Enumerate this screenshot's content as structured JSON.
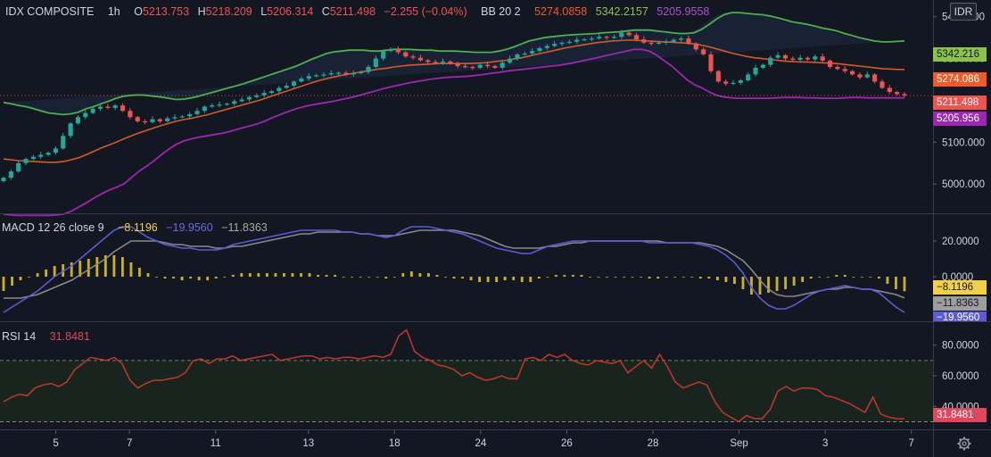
{
  "header": {
    "symbol": "IDX COMPOSITE",
    "interval": "1h",
    "o_label": "O",
    "o_value": "5213.753",
    "h_label": "H",
    "h_value": "5218.209",
    "l_label": "L",
    "l_value": "5206.314",
    "c_label": "C",
    "c_value": "5211.498",
    "change": "−2.255 (−0.04%)",
    "bb_label": "BB 20 2",
    "bb_basis": "5274.0858",
    "bb_upper": "5342.2157",
    "bb_lower": "5205.9558",
    "currency_button": "IDR"
  },
  "macd_header": {
    "label": "MACD 12 26 close 9",
    "hist": "−8.1196",
    "macd": "−19.9560",
    "signal": "−11.8363"
  },
  "rsi_header": {
    "label": "RSI 14",
    "value": "31.8481"
  },
  "price_axis": {
    "ticks": [
      "5400.000",
      "5300.000",
      "5200.000",
      "5100.000",
      "5000.000"
    ],
    "labels": {
      "upper": "5342.216",
      "basis": "5274.086",
      "close": "5211.498",
      "lower": "5205.956"
    }
  },
  "macd_axis": {
    "ticks": [
      "20.0000",
      "0.0000"
    ],
    "labels": {
      "hist": "−8.1196",
      "signal": "−11.8363",
      "macd": "−19.9560"
    }
  },
  "rsi_axis": {
    "ticks": [
      "80.0000",
      "60.0000",
      "40.0000"
    ],
    "label": "31.8481"
  },
  "time_axis": [
    "5",
    "7",
    "11",
    "13",
    "18",
    "24",
    "26",
    "28",
    "Sep",
    "3",
    "7"
  ],
  "colors": {
    "background": "#131722",
    "up": "#26a69a",
    "up_bright": "#4caf50",
    "down": "#ef5350",
    "bb_upper": "#4caf50",
    "bb_basis": "#d35b2a",
    "bb_lower": "#9c27b0",
    "macd_line": "#5b5bd6",
    "signal_line": "#8a8a8a",
    "histogram": "#c9b026",
    "rsi_line": "#c0392b",
    "rsi_band": "#1e2b1e",
    "close_label": "#ef5350",
    "basis_label": "#f05a28",
    "upper_label": "#8bc34a",
    "lower_label": "#9c27b0"
  },
  "chart_data": [
    {
      "type": "candlestick",
      "title": "IDX COMPOSITE",
      "ylim": [
        4930,
        5440
      ],
      "legend": "top-left",
      "grid": false,
      "x_ticks": [
        "5",
        "7",
        "11",
        "13",
        "18",
        "24",
        "26",
        "28",
        "Sep",
        "3",
        "7"
      ],
      "price": [
        5015,
        5030,
        5050,
        5060,
        5065,
        5070,
        5075,
        5085,
        5115,
        5145,
        5160,
        5170,
        5180,
        5185,
        5182,
        5188,
        5175,
        5160,
        5150,
        5148,
        5155,
        5150,
        5157,
        5160,
        5162,
        5167,
        5175,
        5185,
        5188,
        5190,
        5192,
        5198,
        5202,
        5208,
        5212,
        5218,
        5222,
        5230,
        5235,
        5245,
        5252,
        5258,
        5260,
        5262,
        5265,
        5266,
        5262,
        5265,
        5268,
        5280,
        5300,
        5318,
        5322,
        5315,
        5305,
        5302,
        5296,
        5292,
        5290,
        5293,
        5288,
        5282,
        5280,
        5278,
        5285,
        5282,
        5278,
        5290,
        5300,
        5310,
        5312,
        5318,
        5325,
        5330,
        5335,
        5338,
        5340,
        5345,
        5346,
        5348,
        5352,
        5350,
        5352,
        5362,
        5356,
        5346,
        5338,
        5336,
        5338,
        5340,
        5345,
        5348,
        5336,
        5322,
        5310,
        5270,
        5245,
        5240,
        5242,
        5248,
        5262,
        5278,
        5285,
        5302,
        5308,
        5300,
        5297,
        5302,
        5298,
        5305,
        5295,
        5280,
        5275,
        5270,
        5262,
        5255,
        5262,
        5245,
        5230,
        5220,
        5215,
        5212
      ],
      "bb_upper": [
        5195,
        5192,
        5188,
        5185,
        5180,
        5175,
        5170,
        5168,
        5166,
        5168,
        5172,
        5180,
        5185,
        5192,
        5198,
        5205,
        5210,
        5212,
        5213,
        5212,
        5210,
        5208,
        5205,
        5202,
        5203,
        5206,
        5210,
        5215,
        5220,
        5225,
        5230,
        5235,
        5240,
        5246,
        5252,
        5258,
        5264,
        5270,
        5276,
        5282,
        5290,
        5298,
        5305,
        5312,
        5316,
        5318,
        5320,
        5320,
        5320,
        5318,
        5318,
        5320,
        5322,
        5322,
        5322,
        5321,
        5320,
        5320,
        5318,
        5318,
        5318,
        5317,
        5316,
        5315,
        5315,
        5315,
        5318,
        5322,
        5328,
        5335,
        5342,
        5346,
        5350,
        5352,
        5354,
        5356,
        5357,
        5358,
        5359,
        5360,
        5362,
        5363,
        5364,
        5366,
        5368,
        5368,
        5368,
        5366,
        5364,
        5362,
        5360,
        5360,
        5362,
        5370,
        5382,
        5395,
        5405,
        5410,
        5410,
        5408,
        5406,
        5405,
        5402,
        5398,
        5393,
        5388,
        5385,
        5382,
        5378,
        5373,
        5370,
        5366,
        5360,
        5355,
        5350,
        5346,
        5342,
        5340,
        5340,
        5341,
        5342
      ],
      "bb_basis": [
        5060,
        5058,
        5056,
        5055,
        5054,
        5053,
        5052,
        5052,
        5054,
        5058,
        5063,
        5070,
        5078,
        5086,
        5093,
        5100,
        5108,
        5115,
        5122,
        5128,
        5134,
        5140,
        5145,
        5150,
        5154,
        5157,
        5161,
        5165,
        5170,
        5175,
        5180,
        5185,
        5190,
        5195,
        5200,
        5206,
        5212,
        5218,
        5224,
        5230,
        5236,
        5242,
        5247,
        5252,
        5256,
        5260,
        5263,
        5266,
        5269,
        5272,
        5275,
        5277,
        5280,
        5282,
        5284,
        5285,
        5286,
        5287,
        5288,
        5288,
        5288,
        5288,
        5288,
        5289,
        5290,
        5292,
        5294,
        5296,
        5299,
        5302,
        5306,
        5310,
        5314,
        5318,
        5322,
        5326,
        5329,
        5332,
        5335,
        5338,
        5340,
        5342,
        5343,
        5344,
        5344,
        5343,
        5342,
        5341,
        5340,
        5339,
        5338,
        5337,
        5335,
        5332,
        5328,
        5323,
        5318,
        5313,
        5309,
        5305,
        5302,
        5300,
        5298,
        5296,
        5294,
        5293,
        5292,
        5292,
        5291,
        5290,
        5289,
        5288,
        5286,
        5284,
        5282,
        5280,
        5278,
        5276,
        5275,
        5274,
        5274
      ],
      "bb_lower": [
        4928,
        4926,
        4925,
        4925,
        4925,
        4925,
        4925,
        4926,
        4928,
        4935,
        4945,
        4955,
        4966,
        4976,
        4985,
        4992,
        5000,
        5015,
        5030,
        5042,
        5055,
        5070,
        5083,
        5095,
        5103,
        5108,
        5112,
        5115,
        5118,
        5121,
        5125,
        5130,
        5135,
        5140,
        5145,
        5152,
        5160,
        5167,
        5174,
        5180,
        5185,
        5189,
        5192,
        5195,
        5198,
        5202,
        5206,
        5210,
        5215,
        5220,
        5225,
        5230,
        5234,
        5238,
        5242,
        5245,
        5248,
        5251,
        5253,
        5255,
        5256,
        5257,
        5258,
        5260,
        5262,
        5265,
        5267,
        5270,
        5272,
        5274,
        5276,
        5278,
        5280,
        5282,
        5284,
        5287,
        5290,
        5294,
        5298,
        5302,
        5306,
        5310,
        5314,
        5318,
        5322,
        5322,
        5318,
        5308,
        5295,
        5282,
        5266,
        5250,
        5238,
        5230,
        5220,
        5212,
        5208,
        5206,
        5205,
        5205,
        5205,
        5205,
        5205,
        5206,
        5207,
        5207,
        5207,
        5206,
        5206,
        5205,
        5205,
        5205,
        5206,
        5207,
        5207,
        5206,
        5206,
        5206,
        5206,
        5206,
        5206
      ],
      "current_close": 5211.498
    },
    {
      "type": "line",
      "title": "MACD 12 26 close 9",
      "ylim": [
        -25,
        35
      ],
      "grid": false,
      "series": [
        {
          "name": "MACD",
          "values": [
            -20,
            -17,
            -14,
            -11,
            -8,
            -4,
            0,
            3,
            6,
            10,
            14,
            18,
            22,
            26,
            28,
            28,
            25,
            22,
            20,
            18,
            17,
            16,
            16,
            15,
            15,
            15,
            16,
            18,
            19,
            20,
            21,
            22,
            23,
            24,
            25,
            26,
            26,
            26,
            26,
            26,
            25,
            25,
            24,
            24,
            23,
            22,
            23,
            26,
            28,
            28,
            28,
            27,
            26,
            25,
            24,
            22,
            20,
            18,
            16,
            15,
            14,
            13,
            13,
            15,
            17,
            18,
            19,
            20,
            20,
            20,
            20,
            20,
            20,
            20,
            20,
            20,
            19,
            19,
            19,
            19,
            19,
            19,
            18,
            17,
            15,
            12,
            8,
            2,
            -6,
            -12,
            -16,
            -18,
            -18,
            -16,
            -13,
            -10,
            -8,
            -7,
            -6,
            -5,
            -6,
            -7,
            -7,
            -9,
            -13,
            -17,
            -20
          ]
        },
        {
          "name": "Signal",
          "values": [
            -12,
            -12,
            -12,
            -11,
            -10,
            -8,
            -6,
            -4,
            -2,
            1,
            4,
            7,
            10,
            14,
            17,
            20,
            20,
            20,
            20,
            19,
            18,
            18,
            17,
            17,
            17,
            16,
            16,
            17,
            17,
            18,
            19,
            20,
            21,
            22,
            23,
            24,
            24,
            25,
            25,
            25,
            25,
            25,
            24,
            24,
            23,
            23,
            23,
            24,
            25,
            26,
            26,
            26,
            26,
            26,
            25,
            24,
            23,
            21,
            19,
            17,
            16,
            16,
            16,
            16,
            17,
            17,
            18,
            19,
            19,
            20,
            20,
            20,
            20,
            20,
            20,
            20,
            20,
            20,
            19,
            19,
            19,
            19,
            19,
            18,
            17,
            15,
            12,
            9,
            4,
            -2,
            -7,
            -10,
            -11,
            -11,
            -10,
            -9,
            -8,
            -7,
            -7,
            -6,
            -6,
            -7,
            -7,
            -8,
            -9,
            -10,
            -11.84
          ]
        },
        {
          "name": "Histogram",
          "values": [
            -8,
            -5,
            -2,
            0,
            2,
            4,
            6,
            7,
            8,
            9,
            10,
            11,
            12,
            12,
            11,
            8,
            5,
            2,
            0,
            -1,
            -1,
            -2,
            -1,
            -2,
            -2,
            -1,
            0,
            1,
            2,
            2,
            2,
            2,
            2,
            2,
            2,
            2,
            2,
            1,
            1,
            1,
            0,
            0,
            0,
            0,
            0,
            -1,
            0,
            2,
            3,
            2,
            2,
            1,
            0,
            -1,
            -1,
            -2,
            -3,
            -3,
            -3,
            -2,
            -2,
            -3,
            -3,
            -1,
            0,
            1,
            1,
            1,
            1,
            0,
            0,
            0,
            0,
            0,
            0,
            0,
            -1,
            -1,
            0,
            0,
            0,
            0,
            -1,
            -1,
            -2,
            -3,
            -4,
            -7,
            -10,
            -10,
            -9,
            -8,
            -7,
            -5,
            -3,
            -1,
            0,
            0,
            1,
            1,
            0,
            0,
            0,
            -1,
            -4,
            -7,
            -8.12
          ]
        }
      ]
    },
    {
      "type": "line",
      "title": "RSI 14",
      "ylim": [
        25,
        95
      ],
      "grid": false,
      "bands": [
        30,
        70
      ],
      "series": [
        {
          "name": "RSI",
          "values": [
            43,
            46,
            48,
            47,
            52,
            54,
            55,
            53,
            56,
            64,
            68,
            72,
            71,
            70,
            72,
            68,
            57,
            52,
            55,
            57,
            57,
            58,
            59,
            62,
            70,
            71,
            68,
            71,
            71,
            73,
            70,
            71,
            72,
            73,
            74,
            70,
            71,
            72,
            73,
            73,
            71,
            72,
            71,
            72,
            72,
            71,
            72,
            73,
            72,
            74,
            86,
            90,
            76,
            72,
            70,
            67,
            66,
            64,
            60,
            62,
            59,
            57,
            58,
            60,
            58,
            58,
            71,
            72,
            70,
            74,
            72,
            74,
            70,
            68,
            67,
            70,
            69,
            68,
            70,
            62,
            66,
            70,
            65,
            74,
            66,
            56,
            52,
            54,
            56,
            54,
            43,
            36,
            33,
            30,
            34,
            32,
            32,
            38,
            50,
            53,
            50,
            52,
            52,
            51,
            47,
            46,
            44,
            42,
            39,
            36,
            46,
            35,
            33,
            32,
            31.85
          ]
        }
      ]
    }
  ]
}
